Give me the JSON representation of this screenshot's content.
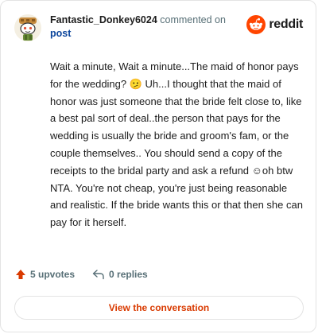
{
  "author": {
    "username": "Fantastic_Donkey6024",
    "action_text": "commented on",
    "post_link": "post",
    "avatar_icon": "snoo-avatar-icon"
  },
  "brand": {
    "name": "reddit",
    "icon": "reddit-logo-icon",
    "color": "#ff4500"
  },
  "comment": {
    "text": "Wait a minute, Wait a minute...The maid of honor pays for the wedding? 🫤 Uh...I thought that the maid of honor was just someone that the bride felt close to, like a best pal sort of deal..the person that pays for the wedding is usually the bride and groom's fam, or the couple themselves.. You should send a copy of the receipts to the bridal party and ask a refund ☺︎oh btw NTA. You're not cheap, you're just being reasonable and realistic. If the bride wants this or that then she can pay for it herself."
  },
  "stats": {
    "upvotes_label": "5 upvotes",
    "replies_label": "0 replies",
    "upvote_icon": "upvote-arrow-icon",
    "reply_icon": "reply-arrow-icon",
    "upvote_color": "#d93a00"
  },
  "cta": {
    "label": "View the conversation",
    "color": "#d93a00"
  }
}
